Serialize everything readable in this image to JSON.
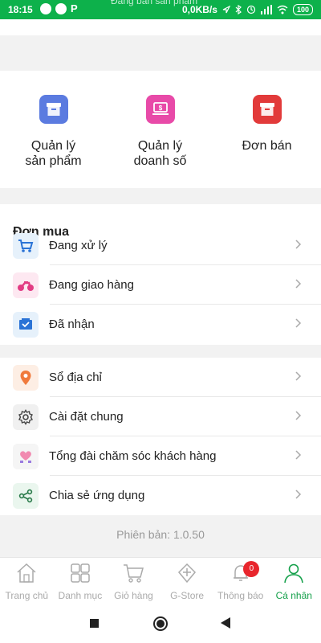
{
  "status_bar": {
    "time": "18:15",
    "notice": "Đang bán sản phẩm",
    "speed": "0,0KB/s",
    "battery": "100"
  },
  "shop": {
    "items": [
      {
        "label": "Quản lý\nsản phẩm",
        "color": "#5b7be0",
        "icon": "box-icon"
      },
      {
        "label": "Quản lý\ndoanh số",
        "color": "#e84aa8",
        "icon": "laptop-dollar-icon"
      },
      {
        "label": "Đơn bán",
        "color": "#e23a3a",
        "icon": "box-icon"
      }
    ]
  },
  "orders": {
    "title": "Đơn mua",
    "items": [
      {
        "label": "Đang xử lý",
        "icon": "cart-icon"
      },
      {
        "label": "Đang giao hàng",
        "icon": "motorbike-icon"
      },
      {
        "label": "Đã nhận",
        "icon": "received-box-icon"
      }
    ]
  },
  "settings": {
    "items": [
      {
        "label": "Sổ địa chỉ",
        "icon": "location-pin-icon"
      },
      {
        "label": "Cài đặt chung",
        "icon": "gear-icon"
      },
      {
        "label": "Tổng đài chăm sóc khách hàng",
        "icon": "support-heart-icon"
      },
      {
        "label": "Chia sẻ ứng dụng",
        "icon": "share-icon"
      }
    ]
  },
  "version": "Phiên bản: 1.0.50",
  "bottom_nav": {
    "items": [
      {
        "label": "Trang chủ",
        "icon": "home-icon"
      },
      {
        "label": "Danh mục",
        "icon": "grid-icon"
      },
      {
        "label": "Giỏ hàng",
        "icon": "cart-icon"
      },
      {
        "label": "G-Store",
        "icon": "store-icon"
      },
      {
        "label": "Thông báo",
        "icon": "bell-icon",
        "badge": "0"
      },
      {
        "label": "Cá nhân",
        "icon": "user-icon",
        "active": true
      }
    ]
  },
  "colors": {
    "accent": "#14a04a",
    "badge": "#e8262d"
  }
}
